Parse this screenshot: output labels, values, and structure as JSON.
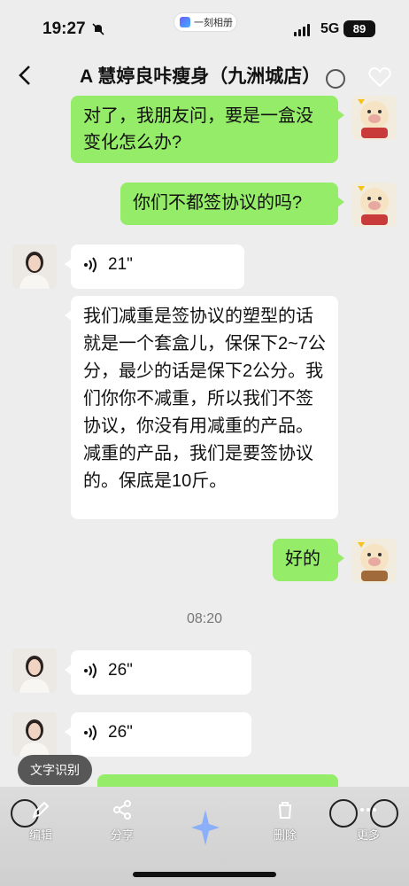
{
  "status_bar": {
    "time": "19:27",
    "network": "5G",
    "battery": "89",
    "album_pill": "一刻相册"
  },
  "nav": {
    "title": "A 慧婷良咔瘦身（九洲城店）"
  },
  "messages": [
    {
      "side": "right",
      "type": "text",
      "text": "对了，我朋友问，要是一盒没变化怎么办?"
    },
    {
      "side": "right",
      "type": "text",
      "text": "你们不都签协议的吗?"
    },
    {
      "side": "left",
      "type": "voice",
      "duration": "21\""
    },
    {
      "side": "left",
      "type": "text",
      "text": "我们减重是签协议的塑型的话就是一个套盒儿，保保下2~7公分，最少的话是保下2公分。我们你你不减重，所以我们不签协议，你没有用减重的产品。减重的产品，我们是要签协议的。保底是10斤。"
    },
    {
      "side": "right",
      "type": "text",
      "text": "好的"
    },
    {
      "side": "left",
      "type": "voice",
      "duration": "26\""
    },
    {
      "side": "left",
      "type": "voice",
      "duration": "26\""
    }
  ],
  "time_divider": "08:20",
  "ocr_chip": "文字识别",
  "toolbar": {
    "edit": "编辑",
    "share": "分享",
    "delete": "删除",
    "more": "更多"
  }
}
